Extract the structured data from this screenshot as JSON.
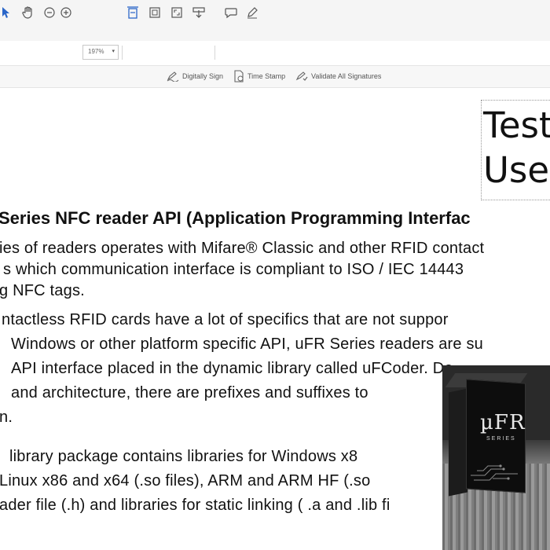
{
  "toolbar": {
    "zoom_value": "197%",
    "zoom_arrow": "▾"
  },
  "signature_bar": {
    "digitally_sign": "Digitally Sign",
    "time_stamp": "Time Stamp",
    "validate_all": "Validate All Signatures"
  },
  "document": {
    "test_lines": [
      "Test",
      "User"
    ],
    "heading": "Series NFC reader API (Application Programming Interfac",
    "lines": [
      "ies of readers operates with Mifare® Classic and other RFID contact",
      "s which communication interface is compliant to ISO / IEC 14443",
      "g NFC tags.",
      "ntactless RFID cards have a lot of specifics that are not suppor",
      "Windows or other platform specific API, uFR Series readers are su",
      "API interface placed in the dynamic library called  uFCoder. De",
      "and architecture, there are prefixes and suffixes to",
      "n.",
      "library package contains libraries for  Windows x8",
      "Linux x86 and x64 (.so files), ARM and ARM HF (.so",
      "ader file (.h) and libraries for static linking ( .a and .lib fi"
    ]
  },
  "video_overlay": {
    "logo_text": "µFR",
    "series_text": "SERIES"
  },
  "colors": {
    "accent_blue": "#2b66c8",
    "text": "#111111"
  }
}
